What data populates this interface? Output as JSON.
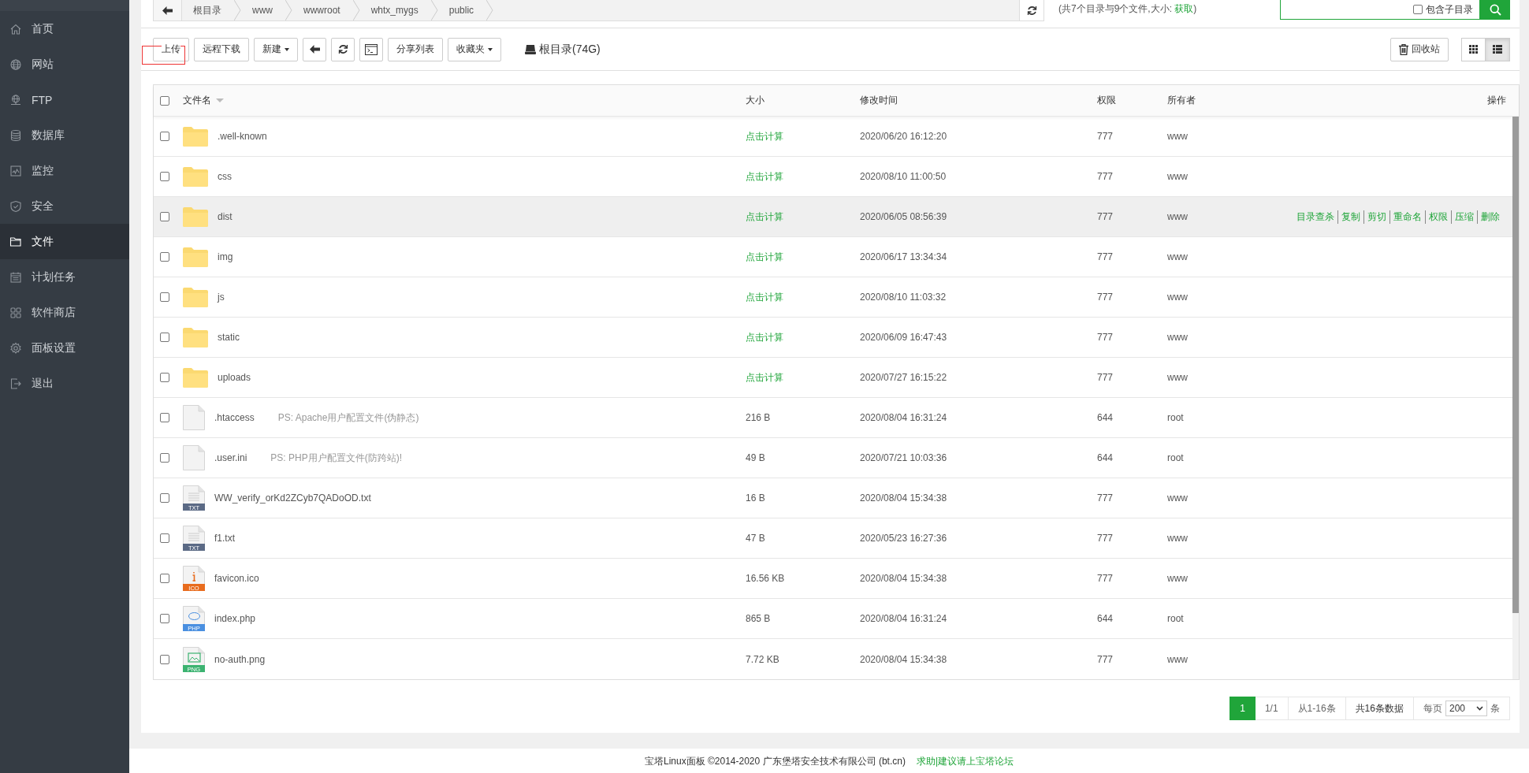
{
  "sidebar": {
    "items": [
      {
        "label": "首页",
        "kind": "home",
        "selected": false
      },
      {
        "label": "网站",
        "kind": "globe",
        "selected": false
      },
      {
        "label": "FTP",
        "kind": "ftp",
        "selected": false
      },
      {
        "label": "数据库",
        "kind": "database",
        "selected": false
      },
      {
        "label": "监控",
        "kind": "monitor",
        "selected": false
      },
      {
        "label": "安全",
        "kind": "shield",
        "selected": false
      },
      {
        "label": "文件",
        "kind": "folder",
        "selected": true
      },
      {
        "label": "计划任务",
        "kind": "calendar",
        "selected": false
      },
      {
        "label": "软件商店",
        "kind": "apps",
        "selected": false
      },
      {
        "label": "面板设置",
        "kind": "gear",
        "selected": false
      },
      {
        "label": "退出",
        "kind": "logout",
        "selected": false
      }
    ]
  },
  "breadcrumb": {
    "crumbs": [
      "根目录",
      "www",
      "wwwroot",
      "whtx_mygs",
      "public"
    ]
  },
  "summary": {
    "before": "(共7个目录与9个文件,大小: ",
    "link": "获取",
    "after": ")"
  },
  "search": {
    "include_subdirs": {
      "label": "包含子目录",
      "checked": false
    }
  },
  "toolbar": {
    "buttons": [
      {
        "kind": "text",
        "label": "上传",
        "highlighted": true
      },
      {
        "kind": "text",
        "label": "远程下载",
        "highlighted": false
      },
      {
        "kind": "dropdown",
        "label": "新建",
        "highlighted": false
      },
      {
        "kind": "back",
        "highlighted": false
      },
      {
        "kind": "refresh",
        "highlighted": false
      },
      {
        "kind": "terminal",
        "highlighted": false
      },
      {
        "kind": "text",
        "label": "分享列表",
        "highlighted": false
      },
      {
        "kind": "dropdown",
        "label": "收藏夹",
        "highlighted": false
      }
    ],
    "disk": "根目录(74G)",
    "recycle": "回收站",
    "views": [
      {
        "kind": "grid",
        "selected": false
      },
      {
        "kind": "list",
        "selected": true
      }
    ]
  },
  "table": {
    "select_all": false,
    "columns": [
      "文件名",
      "大小",
      "修改时间",
      "权限",
      "所有者",
      "操作"
    ],
    "rows": [
      {
        "name": ".well-known",
        "kind": "folder",
        "size": "点击计算",
        "modified": "2020/06/20 16:12:20",
        "permission": "777",
        "owner": "www",
        "checked": false,
        "highlighted": false
      },
      {
        "name": "css",
        "kind": "folder",
        "size": "点击计算",
        "modified": "2020/08/10 11:00:50",
        "permission": "777",
        "owner": "www",
        "checked": false,
        "highlighted": false
      },
      {
        "name": "dist",
        "kind": "folder",
        "size": "点击计算",
        "modified": "2020/06/05 08:56:39",
        "permission": "777",
        "owner": "www",
        "checked": false,
        "highlighted": true,
        "actions": [
          "目录查杀",
          "复制",
          "剪切",
          "重命名",
          "权限",
          "压缩",
          "删除"
        ]
      },
      {
        "name": "img",
        "kind": "folder",
        "size": "点击计算",
        "modified": "2020/06/17 13:34:34",
        "permission": "777",
        "owner": "www",
        "checked": false,
        "highlighted": false
      },
      {
        "name": "js",
        "kind": "folder",
        "size": "点击计算",
        "modified": "2020/08/10 11:03:32",
        "permission": "777",
        "owner": "www",
        "checked": false,
        "highlighted": false
      },
      {
        "name": "static",
        "kind": "folder",
        "size": "点击计算",
        "modified": "2020/06/09 16:47:43",
        "permission": "777",
        "owner": "www",
        "checked": false,
        "highlighted": false
      },
      {
        "name": "uploads",
        "kind": "folder",
        "size": "点击计算",
        "modified": "2020/07/27 16:15:22",
        "permission": "777",
        "owner": "www",
        "checked": false,
        "highlighted": false
      },
      {
        "name": ".htaccess",
        "kind": "blank",
        "note": "PS: Apache用户配置文件(伪静态)",
        "size": "216 B",
        "modified": "2020/08/04 16:31:24",
        "permission": "644",
        "owner": "root",
        "checked": false,
        "highlighted": false
      },
      {
        "name": ".user.ini",
        "kind": "blank",
        "note": "PS: PHP用户配置文件(防跨站)!",
        "size": "49 B",
        "modified": "2020/07/21 10:03:36",
        "permission": "644",
        "owner": "root",
        "checked": false,
        "highlighted": false
      },
      {
        "name": "WW_verify_orKd2ZCyb7QADoOD.txt",
        "kind": "txt",
        "badge": "TXT",
        "size": "16 B",
        "modified": "2020/08/04 15:34:38",
        "permission": "777",
        "owner": "www",
        "checked": false,
        "highlighted": false
      },
      {
        "name": "f1.txt",
        "kind": "txt",
        "badge": "TXT",
        "size": "47 B",
        "modified": "2020/05/23 16:27:36",
        "permission": "777",
        "owner": "www",
        "checked": false,
        "highlighted": false
      },
      {
        "name": "favicon.ico",
        "kind": "ico",
        "badge": "ICO",
        "size": "16.56 KB",
        "modified": "2020/08/04 15:34:38",
        "permission": "777",
        "owner": "www",
        "checked": false,
        "highlighted": false
      },
      {
        "name": "index.php",
        "kind": "php",
        "badge": "PHP",
        "size": "865 B",
        "modified": "2020/08/04 16:31:24",
        "permission": "644",
        "owner": "root",
        "checked": false,
        "highlighted": false
      },
      {
        "name": "no-auth.png",
        "kind": "png",
        "badge": "PNG",
        "size": "7.72 KB",
        "modified": "2020/08/04 15:34:38",
        "permission": "777",
        "owner": "www",
        "checked": false,
        "highlighted": false
      }
    ]
  },
  "pagination": {
    "pages": [
      {
        "label": "1",
        "selected": true
      }
    ],
    "page_count": "1/1",
    "range": "从1-16条",
    "total": "共16条数据",
    "per_page_label": "每页",
    "per_page": "200",
    "per_page_unit": "条"
  },
  "footer": {
    "copyright": "宝塔Linux面板 ©2014-2020 广东堡塔安全技术有限公司 (bt.cn)",
    "link": "求助|建议请上宝塔论坛"
  }
}
